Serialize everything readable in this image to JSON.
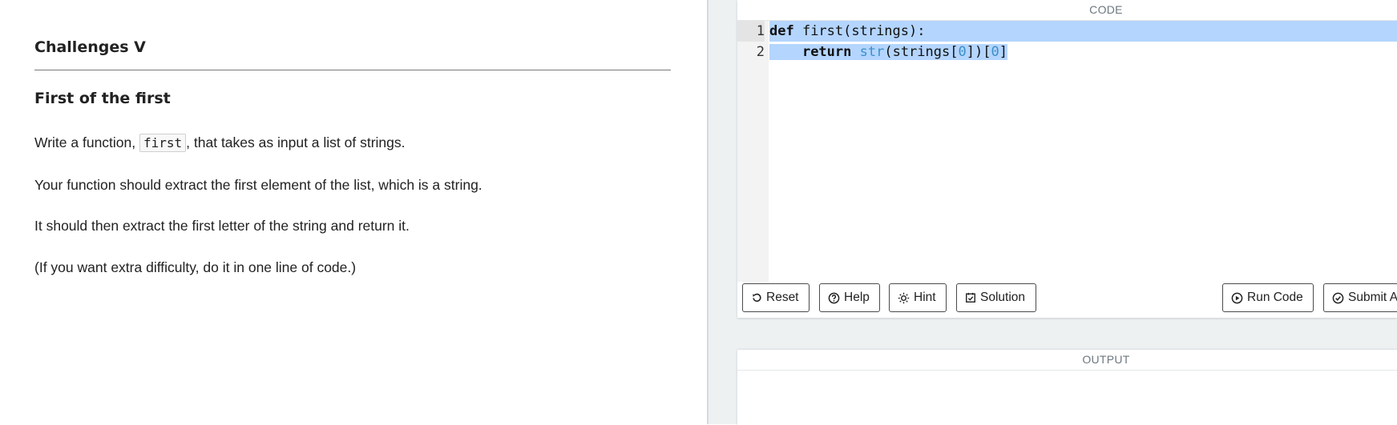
{
  "lesson": {
    "section_title": "Challenges V",
    "challenge_title": "First of the first",
    "para1_before": "Write a function, ",
    "para1_code": "first",
    "para1_after": ", that takes as input a list of strings.",
    "para2": "Your function should extract the first element of the list, which is a string.",
    "para3": "It should then extract the first letter of the string and return it.",
    "para4": "(If you want extra difficulty, do it in one line of code.)"
  },
  "editor": {
    "label": "CODE",
    "line_numbers": [
      "1",
      "2"
    ],
    "line1": {
      "kw": "def",
      "rest": " first(strings):"
    },
    "line2": {
      "indent": "    ",
      "kw": "return",
      "sp": " ",
      "builtin": "str",
      "p1": "(strings[",
      "n1": "0",
      "p2": "])[",
      "n2": "0",
      "p3": "]"
    },
    "buttons": {
      "reset": "Reset",
      "help": "Help",
      "hint": "Hint",
      "solution": "Solution",
      "run": "Run Code",
      "submit": "Submit A"
    }
  },
  "output": {
    "label": "OUTPUT"
  },
  "icons": {
    "reset": "reset-icon",
    "help": "help-circle-icon",
    "hint": "sun-icon",
    "solution": "check-square-icon",
    "run": "play-circle-icon",
    "submit": "check-circle-icon"
  }
}
